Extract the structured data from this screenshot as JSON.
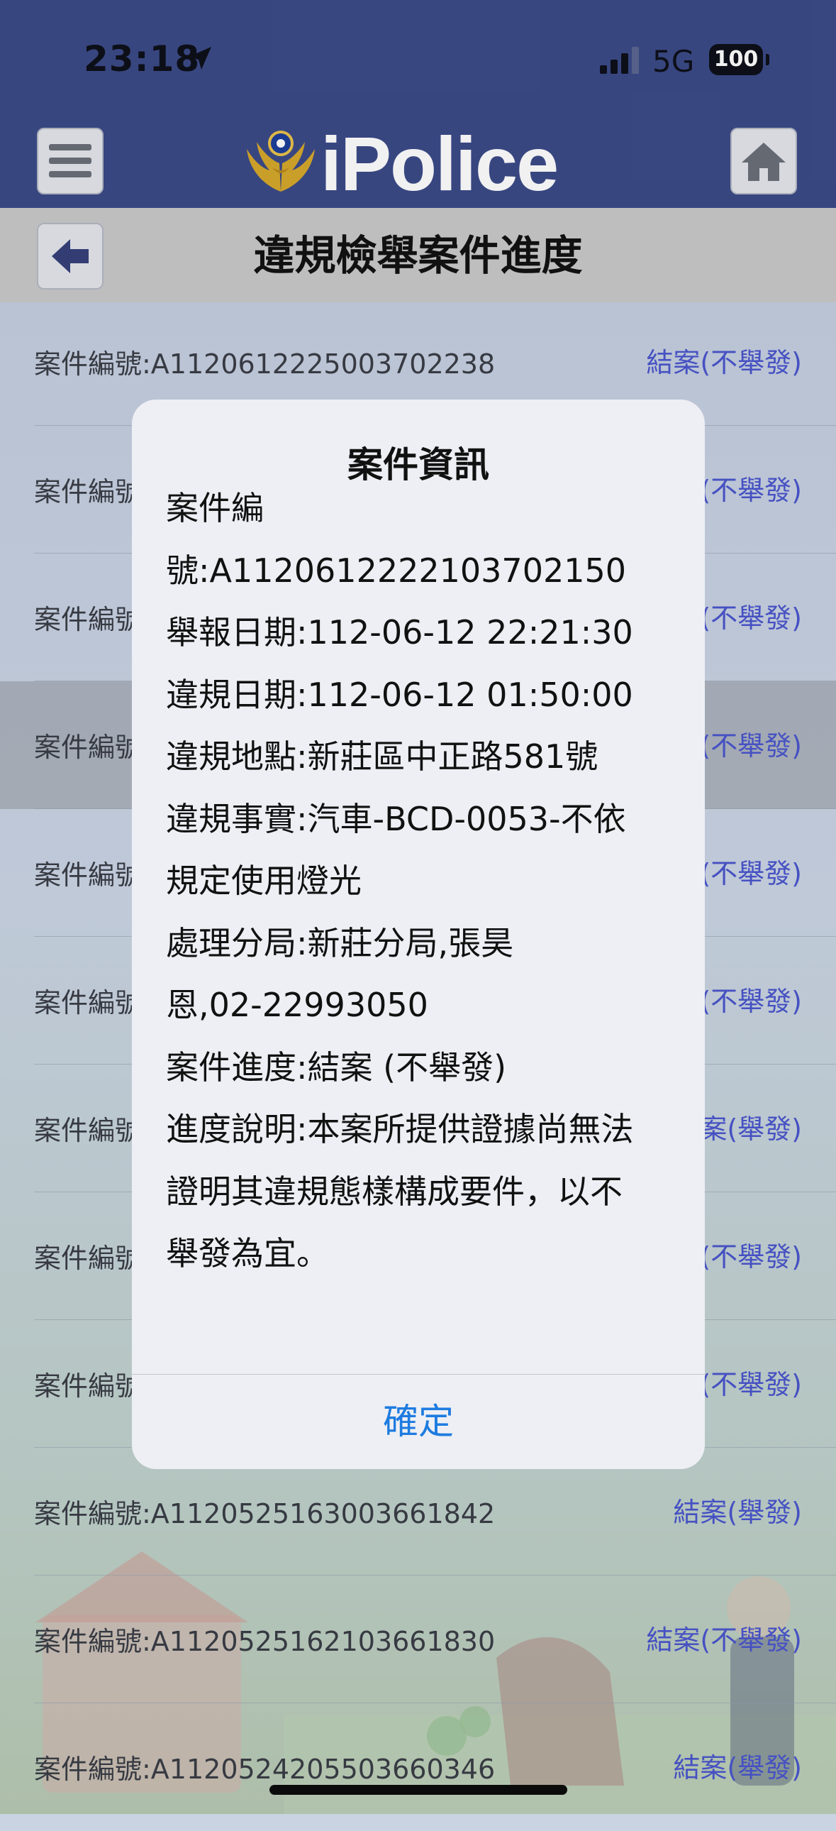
{
  "status_bar": {
    "time": "23:18",
    "network": "5G",
    "battery": "100"
  },
  "header": {
    "brand": "iPolice",
    "page_title": "違規檢舉案件進度"
  },
  "icons": {
    "menu": "hamburger-icon",
    "home": "home-icon",
    "back": "back-arrow-icon",
    "emblem": "police-emblem-icon"
  },
  "list": [
    {
      "id": "案件編號:A1120612225003702238",
      "status": "結案(不舉發)"
    },
    {
      "id": "案件編號",
      "status": "(不舉發)"
    },
    {
      "id": "案件編號",
      "status": "(不舉發)"
    },
    {
      "id": "案件編號",
      "status": "(不舉發)"
    },
    {
      "id": "案件編號",
      "status": "(不舉發)"
    },
    {
      "id": "案件編號",
      "status": "(不舉發)"
    },
    {
      "id": "案件編號",
      "status": "案(舉發)"
    },
    {
      "id": "案件編號",
      "status": "(不舉發)"
    },
    {
      "id": "案件編號",
      "status": "(不舉發)"
    },
    {
      "id": "案件編號:A1120525163003661842",
      "status": "結案(舉發)"
    },
    {
      "id": "案件編號:A1120525162103661830",
      "status": "結案(不舉發)"
    },
    {
      "id": "案件編號:A1120524205503660346",
      "status": "結案(舉發)"
    }
  ],
  "dialog": {
    "title": "案件資訊",
    "lines": [
      "案件編",
      "號:A1120612222103702150",
      "舉報日期:112-06-12 22:21:30",
      "違規日期:112-06-12 01:50:00",
      "違規地點:新莊區中正路581號",
      "違規事實:汽車-BCD-0053-不依",
      "規定使用燈光",
      "處理分局:新莊分局,張昊",
      "恩,02-22993050",
      "案件進度:結案 (不舉發)",
      "進度說明:本案所提供證據尚無法",
      "證明其違規態樣構成要件，以不",
      "舉發為宜。"
    ],
    "ok_label": "確定"
  },
  "colors": {
    "header_bg": "#3b4a86",
    "status_link": "#4a55cc",
    "ok_button": "#1e7be0"
  }
}
